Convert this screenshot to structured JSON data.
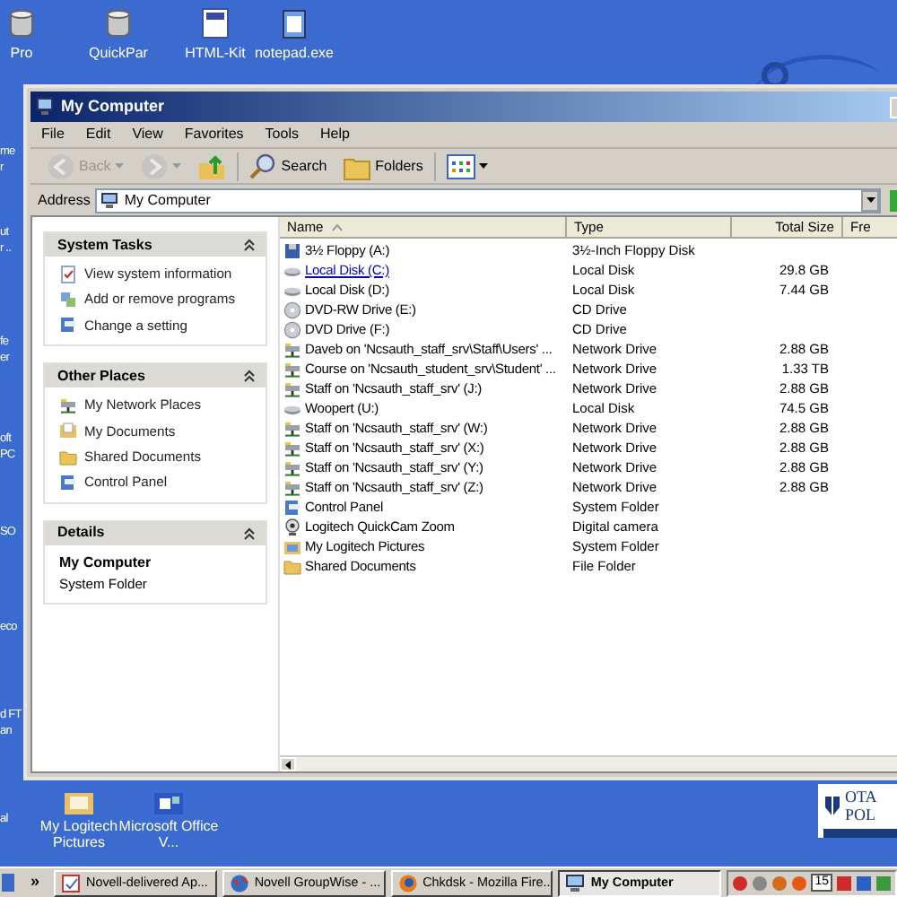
{
  "desktop": {
    "top_icons": [
      {
        "label": "Pro",
        "kind": "db"
      },
      {
        "label": "QuickPar",
        "kind": "db"
      },
      {
        "label": "HTML-Kit",
        "kind": "doc"
      },
      {
        "label": "notepad.exe",
        "kind": "note"
      }
    ],
    "left_icons": [
      {
        "lines": [
          "me",
          "r"
        ]
      },
      {
        "lines": [
          "ut",
          "r .."
        ]
      },
      {
        "lines": [
          "fe",
          "er"
        ]
      },
      {
        "lines": [
          "oft",
          "PC"
        ]
      },
      {
        "lines": [
          "SO"
        ]
      },
      {
        "lines": [
          "eco"
        ]
      },
      {
        "lines": [
          "d FT",
          "an"
        ]
      },
      {
        "lines": [
          "al"
        ]
      }
    ],
    "bottom_icons": [
      {
        "label": "My Logitech Pictures",
        "kind": "pictures"
      },
      {
        "label": "Microsoft Office V...",
        "kind": "office"
      }
    ],
    "logo": {
      "line_1": "OTA",
      "line_2": "POL"
    }
  },
  "window": {
    "title": "My Computer",
    "menu": [
      "File",
      "Edit",
      "View",
      "Favorites",
      "Tools",
      "Help"
    ],
    "toolbar": [
      {
        "kind": "back",
        "label": "Back",
        "disabled": true
      },
      {
        "kind": "forward",
        "disabled": true
      },
      {
        "kind": "up",
        "disabled": false
      },
      {
        "kind": "search",
        "label": "Search",
        "disabled": false
      },
      {
        "kind": "folders",
        "label": "Folders",
        "disabled": false
      },
      {
        "kind": "views",
        "disabled": false
      }
    ],
    "address": {
      "label": "Address",
      "value": "My Computer"
    },
    "panels": [
      {
        "kind": "links",
        "title": "System Tasks",
        "expanded": true,
        "items": [
          {
            "label": "View system information",
            "kind": "info"
          },
          {
            "label": "Add or remove programs",
            "kind": "programs"
          },
          {
            "label": "Change a setting",
            "kind": "panel"
          }
        ]
      },
      {
        "kind": "links",
        "title": "Other Places",
        "expanded": true,
        "items": [
          {
            "label": "My Network Places",
            "kind": "network"
          },
          {
            "label": "My Documents",
            "kind": "documents"
          },
          {
            "label": "Shared Documents",
            "kind": "folder"
          },
          {
            "label": "Control Panel",
            "kind": "panel"
          }
        ]
      },
      {
        "kind": "details",
        "title": "Details",
        "expanded": true,
        "name": "My Computer",
        "subtitle": "System Folder"
      }
    ],
    "columns": [
      "Name",
      "Type",
      "Total Size",
      "Fre"
    ],
    "rows": [
      {
        "kind": "floppy",
        "name": "3½ Floppy (A:)",
        "type": "3½-Inch Floppy Disk",
        "size": "",
        "hover": false
      },
      {
        "kind": "disk",
        "name": "Local Disk (C:)",
        "type": "Local Disk",
        "size": "29.8 GB",
        "hover": true
      },
      {
        "kind": "disk",
        "name": "Local Disk (D:)",
        "type": "Local Disk",
        "size": "7.44 GB",
        "hover": false
      },
      {
        "kind": "cd",
        "name": "DVD-RW Drive (E:)",
        "type": "CD Drive",
        "size": "",
        "hover": false
      },
      {
        "kind": "cd",
        "name": "DVD Drive (F:)",
        "type": "CD Drive",
        "size": "",
        "hover": false
      },
      {
        "kind": "network",
        "name": "Daveb on 'Ncsauth_staff_srv\\Staff\\Users' ...",
        "type": "Network Drive",
        "size": "2.88 GB",
        "hover": false
      },
      {
        "kind": "network",
        "name": "Course on 'Ncsauth_student_srv\\Student' ...",
        "type": "Network Drive",
        "size": "1.33 TB",
        "hover": false
      },
      {
        "kind": "network",
        "name": "Staff on 'Ncsauth_staff_srv' (J:)",
        "type": "Network Drive",
        "size": "2.88 GB",
        "hover": false
      },
      {
        "kind": "disk",
        "name": "Woopert (U:)",
        "type": "Local Disk",
        "size": "74.5 GB",
        "hover": false
      },
      {
        "kind": "network",
        "name": "Staff on 'Ncsauth_staff_srv' (W:)",
        "type": "Network Drive",
        "size": "2.88 GB",
        "hover": false
      },
      {
        "kind": "network",
        "name": "Staff on 'Ncsauth_staff_srv' (X:)",
        "type": "Network Drive",
        "size": "2.88 GB",
        "hover": false
      },
      {
        "kind": "network",
        "name": "Staff on 'Ncsauth_staff_srv' (Y:)",
        "type": "Network Drive",
        "size": "2.88 GB",
        "hover": false
      },
      {
        "kind": "network",
        "name": "Staff on 'Ncsauth_staff_srv' (Z:)",
        "type": "Network Drive",
        "size": "2.88 GB",
        "hover": false
      },
      {
        "kind": "panel",
        "name": "Control Panel",
        "type": "System Folder",
        "size": "",
        "hover": false
      },
      {
        "kind": "camera",
        "name": "Logitech QuickCam Zoom",
        "type": "Digital camera",
        "size": "",
        "hover": false
      },
      {
        "kind": "pictures",
        "name": "My Logitech Pictures",
        "type": "System Folder",
        "size": "",
        "hover": false
      },
      {
        "kind": "folder",
        "name": "Shared Documents",
        "type": "File Folder",
        "size": "",
        "hover": false
      }
    ]
  },
  "taskbar": {
    "overflow": "»",
    "tasks": [
      {
        "label": "Novell-delivered Ap...",
        "kind": "app",
        "selected": false
      },
      {
        "label": "Novell GroupWise - ...",
        "kind": "globe",
        "selected": false
      },
      {
        "label": "Chkdsk - Mozilla Fire...",
        "kind": "firefox",
        "selected": false
      },
      {
        "label": "My Computer",
        "kind": "computer",
        "selected": true
      }
    ],
    "tray_date": "15"
  }
}
